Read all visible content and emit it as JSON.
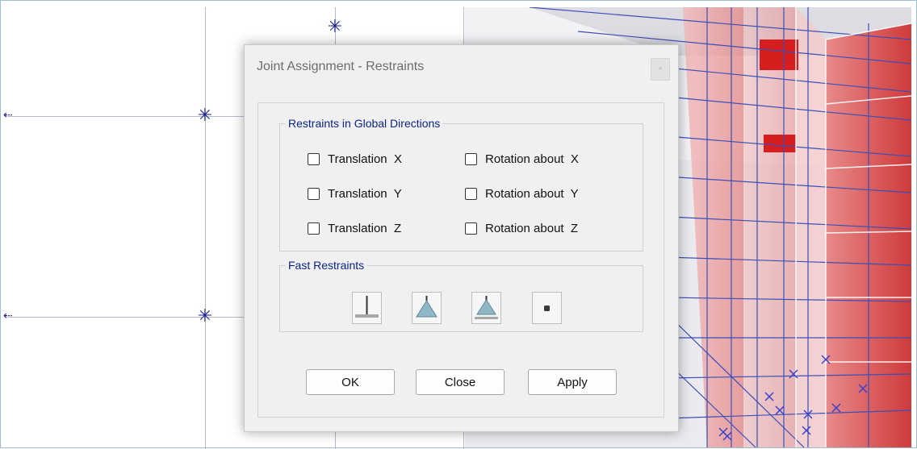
{
  "dialog": {
    "title": "Joint Assignment - Restraints",
    "title_button_glyph": "▫"
  },
  "global_group": {
    "legend": "Restraints in Global Directions",
    "options": [
      {
        "label": "Translation  X",
        "checked": false
      },
      {
        "label": "Translation  Y",
        "checked": false
      },
      {
        "label": "Translation  Z",
        "checked": false
      },
      {
        "label": "Rotation about  X",
        "checked": false
      },
      {
        "label": "Rotation about  Y",
        "checked": false
      },
      {
        "label": "Rotation about  Z",
        "checked": false
      }
    ]
  },
  "fast_group": {
    "legend": "Fast Restraints",
    "buttons": [
      {
        "icon": "fixed-support-icon"
      },
      {
        "icon": "pinned-support-icon"
      },
      {
        "icon": "roller-support-icon"
      },
      {
        "icon": "free-joint-icon"
      }
    ]
  },
  "actions": {
    "ok": "OK",
    "close": "Close",
    "apply": "Apply"
  },
  "colors": {
    "legend_text": "#0b2484",
    "joint_marker": "#1b1f8a",
    "model_wall": "#d94b4b",
    "model_grid": "#3b4fb8"
  }
}
